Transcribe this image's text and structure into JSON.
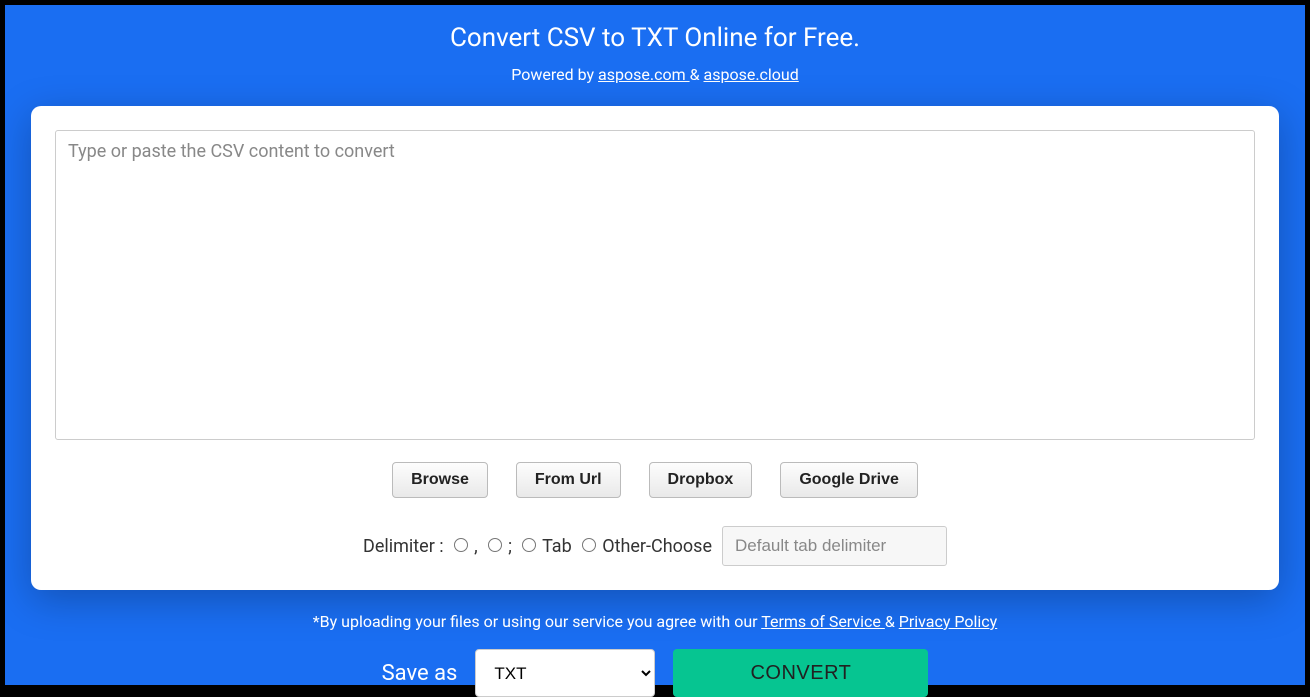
{
  "title": "Convert CSV to TXT Online for Free.",
  "subtitle": {
    "prefix": "Powered by ",
    "link1": "aspose.com ",
    "amp": "& ",
    "link2": "aspose.cloud"
  },
  "textarea": {
    "placeholder": "Type or paste the CSV content to convert"
  },
  "buttons": {
    "browse": "Browse",
    "from_url": "From Url",
    "dropbox": "Dropbox",
    "google_drive": "Google Drive"
  },
  "delimiter": {
    "label": "Delimiter :",
    "comma": ",",
    "semicolon": ";",
    "tab": "Tab",
    "other": "Other-Choose",
    "input_placeholder": "Default tab delimiter"
  },
  "disclaimer": {
    "prefix": "*By uploading your files or using our service you agree with our ",
    "tos": "Terms of Service ",
    "amp": "& ",
    "privacy": "Privacy Policy"
  },
  "save": {
    "label": "Save as",
    "selected": "TXT",
    "convert": "CONVERT"
  }
}
